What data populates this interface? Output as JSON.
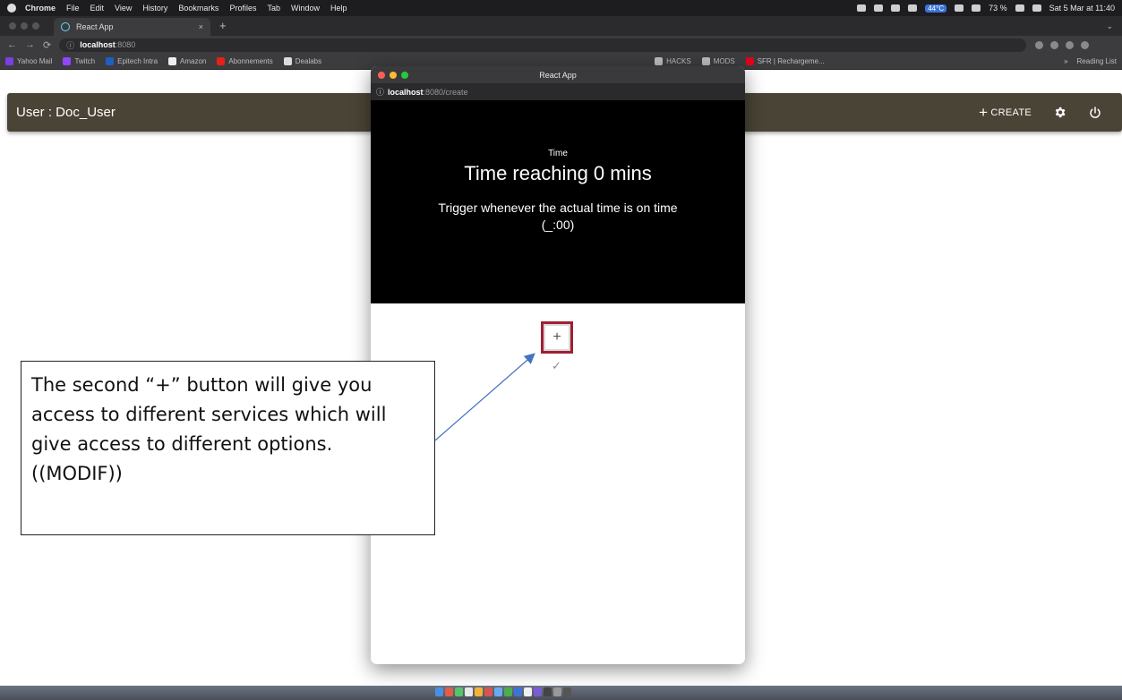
{
  "menubar": {
    "app": "Chrome",
    "items": [
      "File",
      "Edit",
      "View",
      "History",
      "Bookmarks",
      "Profiles",
      "Tab",
      "Window",
      "Help"
    ],
    "temperature": "44°C",
    "battery": "73 %",
    "datetime": "Sat 5 Mar at 11:40"
  },
  "browser": {
    "tab_title": "React App",
    "tab_close": "×",
    "new_tab": "+",
    "url_host": "localhost",
    "url_port": ":8080"
  },
  "bookmarks": {
    "items": [
      "Yahoo Mail",
      "Twitch",
      "Epitech Intra",
      "Amazon",
      "Abonnements",
      "Dealabs"
    ],
    "right_items": [
      "HACKS",
      "MODS",
      "SFR | Rechargeme..."
    ],
    "more": "»",
    "reading_list": "Reading List"
  },
  "appbar": {
    "user": "User : Doc_User",
    "create": "CREATE"
  },
  "popup": {
    "title": "React App",
    "url_host": "localhost",
    "url_path": ":8080/create",
    "trigger_category": "Time",
    "trigger_title": "Time reaching 0 mins",
    "trigger_description": "Trigger whenever the actual time is on time (_:00)",
    "add_label": "+",
    "check_label": "✓"
  },
  "annotation": {
    "text": "The second “+” button will give you access to different services which will give access to different options. ((MODIF))"
  },
  "colors": {
    "appbar": "#4a4436",
    "highlight_border": "#a11f33",
    "arrow": "#4472c4"
  }
}
